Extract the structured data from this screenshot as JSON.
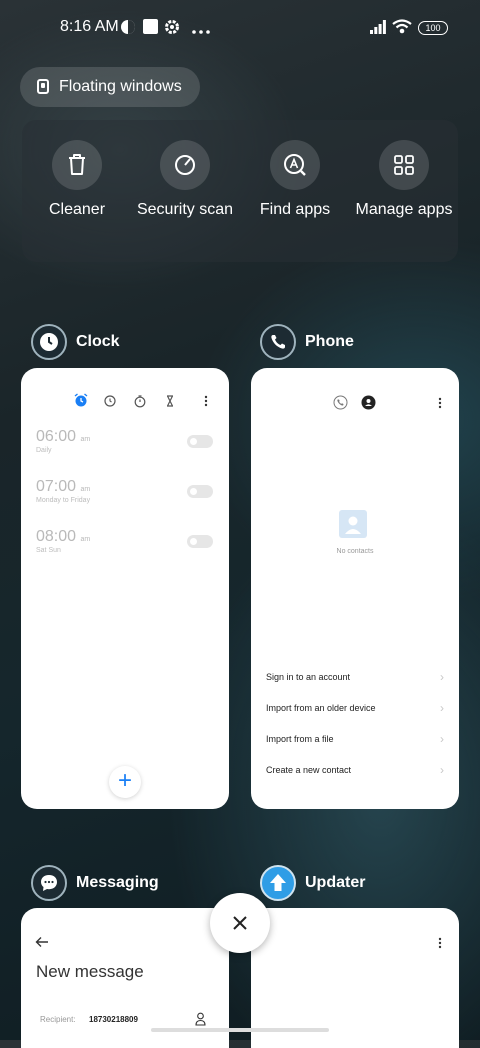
{
  "status": {
    "time": "8:16 AM",
    "battery": "100",
    "icons": [
      "shield-icon",
      "notification-square-icon",
      "gear-icon",
      "more-dots-icon",
      "signal-icon",
      "wifi-icon",
      "battery-icon"
    ]
  },
  "floating_windows": {
    "label": "Floating windows"
  },
  "tools": [
    {
      "label": "Cleaner",
      "icon": "trash-icon"
    },
    {
      "label": "Security scan",
      "icon": "security-gauge-icon"
    },
    {
      "label": "Find apps",
      "icon": "find-apps-icon"
    },
    {
      "label": "Manage apps",
      "icon": "grid-icon"
    }
  ],
  "apps": {
    "clock": {
      "title": "Clock",
      "alarms": [
        {
          "time": "06:00",
          "ampm": "am",
          "repeat": "Daily"
        },
        {
          "time": "07:00",
          "ampm": "am",
          "repeat": "Monday to Friday"
        },
        {
          "time": "08:00",
          "ampm": "am",
          "repeat": "Sat Sun"
        }
      ],
      "add": "+"
    },
    "phone": {
      "title": "Phone",
      "empty_label": "No contacts",
      "actions": [
        "Sign in to an account",
        "Import from an older device",
        "Import from a file",
        "Create a new contact"
      ]
    },
    "messaging": {
      "title": "Messaging",
      "heading": "New message",
      "recipient_label": "Recipient:",
      "recipient_value": "18730218809"
    },
    "updater": {
      "title": "Updater"
    }
  },
  "colors": {
    "accent": "#1a7ff5",
    "updater": "#2f9de6"
  }
}
